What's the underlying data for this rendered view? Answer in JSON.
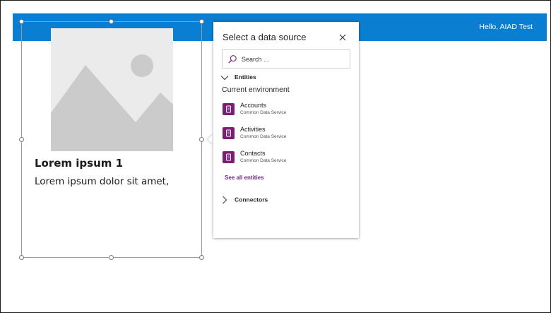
{
  "header": {
    "greeting": "Hello, AIAD Test"
  },
  "card": {
    "title": "Lorem ipsum 1",
    "subtitle": "Lorem ipsum dolor sit amet,"
  },
  "panel": {
    "title": "Select a data source",
    "search": {
      "placeholder": "Search ...",
      "value": ""
    },
    "entities_heading": "Entities",
    "environment_label": "Current environment",
    "entities": [
      {
        "name": "Accounts",
        "source": "Common Data Service"
      },
      {
        "name": "Activities",
        "source": "Common Data Service"
      },
      {
        "name": "Contacts",
        "source": "Common Data Service"
      }
    ],
    "see_all": "See all entities",
    "connectors_heading": "Connectors"
  },
  "colors": {
    "header_bar": "#0a7fd2",
    "entity_icon": "#7a1f74",
    "link": "#6b2a7f"
  },
  "icons": {
    "close": "close-icon",
    "search": "search-icon",
    "entities_toggle": "chevron-down-icon",
    "connectors_toggle": "chevron-right-icon",
    "entity": "table-icon"
  }
}
